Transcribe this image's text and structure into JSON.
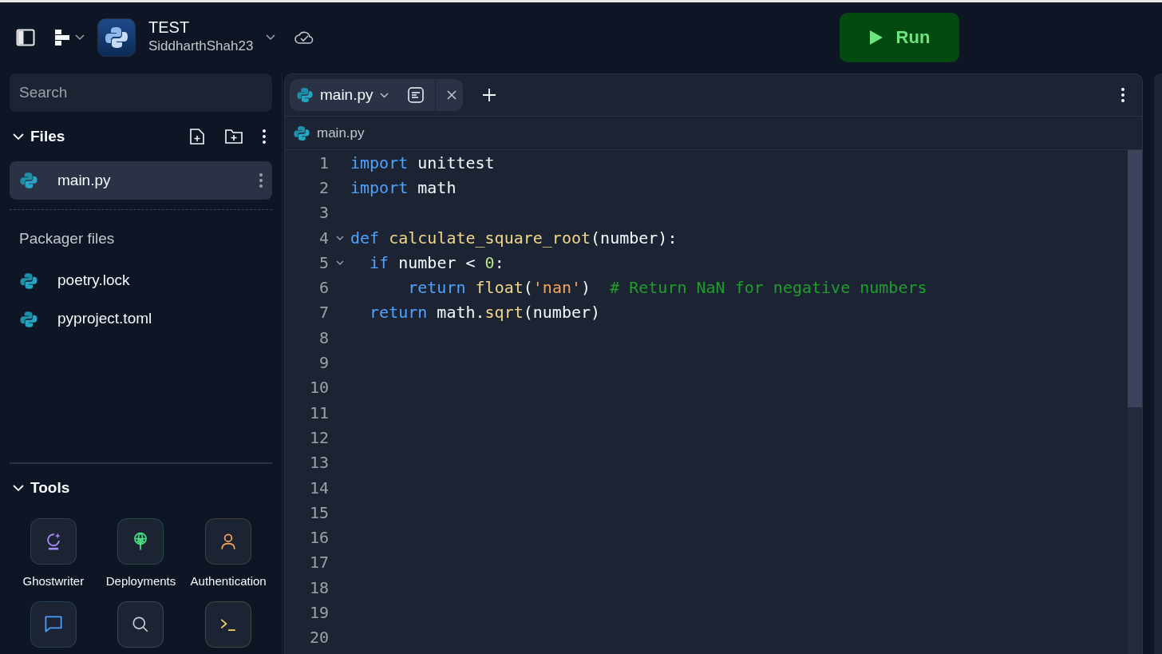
{
  "header": {
    "project_title": "TEST",
    "owner": "SiddharthShah23",
    "run_button": "Run"
  },
  "sidebar": {
    "search": {
      "placeholder": "Search"
    },
    "files_section": {
      "title": "Files",
      "expanded": true,
      "items": [
        {
          "name": "main.py",
          "selected": true
        }
      ]
    },
    "packager_section": {
      "title": "Packager files",
      "items": [
        {
          "name": "poetry.lock",
          "selected": false
        },
        {
          "name": "pyproject.toml",
          "selected": false
        }
      ]
    },
    "tools_section": {
      "title": "Tools",
      "expanded": true,
      "items": [
        {
          "kind": "ghostwriter",
          "label": "Ghostwriter",
          "color": "#a78bfa"
        },
        {
          "kind": "deployments",
          "label": "Deployments",
          "color": "#4ade80"
        },
        {
          "kind": "authentication",
          "label": "Authentication",
          "color": "#f5a65b"
        },
        {
          "kind": "chat",
          "color": "#4a9eff"
        },
        {
          "kind": "search",
          "color": "#c8ccd4"
        },
        {
          "kind": "shell",
          "color": "#f5d76e"
        }
      ]
    }
  },
  "editor": {
    "tabs": [
      {
        "label": "main.py",
        "selected": true
      }
    ],
    "breadcrumb": "main.py",
    "lines": [
      {
        "number": "1",
        "tokens": [
          {
            "kind": "keyword",
            "text": "import"
          },
          {
            "kind": "plain",
            "text": " unittest"
          }
        ]
      },
      {
        "number": "2",
        "tokens": [
          {
            "kind": "keyword",
            "text": "import"
          },
          {
            "kind": "plain",
            "text": " math"
          }
        ]
      },
      {
        "number": "3"
      },
      {
        "number": "4",
        "foldable": true,
        "tokens": [
          {
            "kind": "keyword",
            "text": "def "
          },
          {
            "kind": "function",
            "text": "calculate_square_root"
          },
          {
            "kind": "plain",
            "text": "(number):"
          }
        ]
      },
      {
        "number": "5",
        "foldable": true,
        "tokens": [
          {
            "kind": "keyword",
            "text": "  if"
          },
          {
            "kind": "plain",
            "text": " number < "
          },
          {
            "kind": "number",
            "text": "0"
          },
          {
            "kind": "plain",
            "text": ":"
          }
        ]
      },
      {
        "number": "6",
        "tokens": [
          {
            "kind": "keyword",
            "text": "      return "
          },
          {
            "kind": "function",
            "text": "float"
          },
          {
            "kind": "plain",
            "text": "("
          },
          {
            "kind": "string",
            "text": "'nan'"
          },
          {
            "kind": "plain",
            "text": ")  "
          },
          {
            "kind": "comment",
            "text": "# Return NaN for negative numbers"
          }
        ]
      },
      {
        "number": "7",
        "tokens": [
          {
            "kind": "keyword",
            "text": "  return"
          },
          {
            "kind": "plain",
            "text": " math."
          },
          {
            "kind": "function",
            "text": "sqrt"
          },
          {
            "kind": "plain",
            "text": "(number)"
          }
        ]
      },
      {
        "number": "8"
      },
      {
        "number": "9"
      },
      {
        "number": "10"
      },
      {
        "number": "11"
      },
      {
        "number": "12"
      },
      {
        "number": "13"
      },
      {
        "number": "14"
      },
      {
        "number": "15"
      },
      {
        "number": "16"
      },
      {
        "number": "17"
      },
      {
        "number": "18"
      },
      {
        "number": "19"
      },
      {
        "number": "20"
      }
    ]
  }
}
